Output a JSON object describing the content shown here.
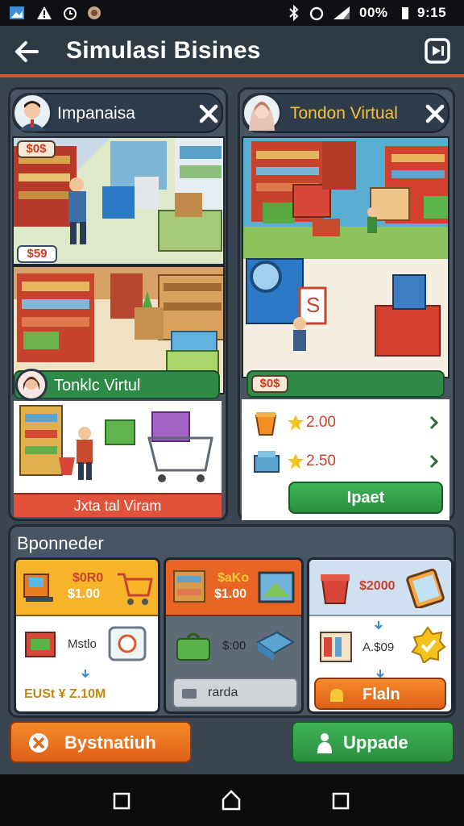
{
  "status_bar": {
    "battery_text": "00%",
    "time": "9:15",
    "icons": [
      "image-icon",
      "warning-icon",
      "alarm-icon",
      "notification-dot-icon",
      "bluetooth-off-icon",
      "alarm-clock-icon",
      "signal-icon"
    ]
  },
  "app_bar": {
    "title": "Simulasi Bisines",
    "back_icon": "arrow-left-icon",
    "action_icon": "exit-icon"
  },
  "left_panel": {
    "name": "Impanaisa",
    "top_tag": "$0$",
    "mid_tag": "$59",
    "sub_title": "Tonklc Virtul",
    "footer": "Jxta tal Viram"
  },
  "right_panel": {
    "name": "Tondon Virtual",
    "price_tag": "$0$",
    "items": [
      {
        "value": "2.00"
      },
      {
        "value": "2.50"
      }
    ],
    "button": "Ipaet"
  },
  "bottom": {
    "heading": "Bponneder",
    "card1": {
      "top_label": "$0R0",
      "top_price": "$1.00",
      "mid_label": "Mstlo",
      "footer": "EUSt ¥ Z.10M"
    },
    "card2": {
      "top_label": "$aKo",
      "top_price": "$1.00",
      "mid_label": "$:00",
      "footer": "rarda"
    },
    "card3": {
      "top_price": "$2000",
      "mid_label": "A.$09",
      "button": "Flaln"
    }
  },
  "actions": {
    "left": "Bystnatiuh",
    "right": "Uppade"
  },
  "colors": {
    "accent": "#d8532d",
    "green": "#2e8b47",
    "orange": "#ef7420",
    "panel": "#4a5563"
  }
}
